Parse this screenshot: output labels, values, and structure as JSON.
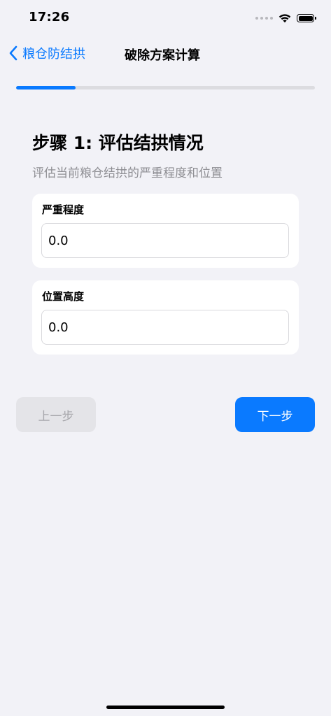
{
  "status_bar": {
    "time": "17:26"
  },
  "nav": {
    "back_label": "粮仓防结拱",
    "title": "破除方案计算"
  },
  "progress": {
    "fraction": 0.2
  },
  "step": {
    "title": "步骤 1: 评估结拱情况",
    "description": "评估当前粮仓结拱的严重程度和位置"
  },
  "fields": {
    "severity": {
      "label": "严重程度",
      "value": "0.0"
    },
    "position_height": {
      "label": "位置高度",
      "value": "0.0"
    }
  },
  "buttons": {
    "prev_label": "上一步",
    "next_label": "下一步"
  },
  "colors": {
    "accent": "#0a7aff",
    "background": "#f2f2f7",
    "disabled_bg": "#e4e4e8",
    "disabled_text": "#a7a7ac"
  }
}
